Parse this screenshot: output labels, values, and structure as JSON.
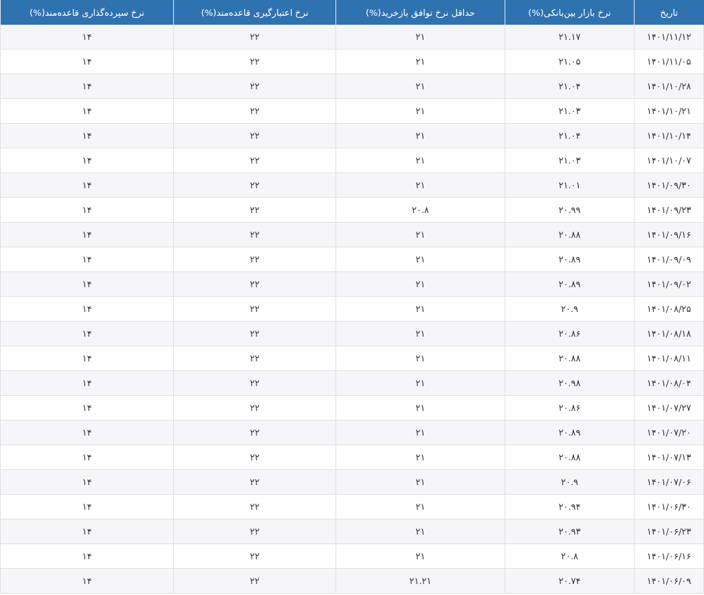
{
  "table": {
    "columns": [
      "تاریخ",
      "نرخ بازار بین‌بانکی(%)",
      "حداقل نرخ توافق بازخرید(%)",
      "نرخ اعتبارگیری قاعده‌مند(%)",
      "نرخ سپرده‌گذاری قاعده‌مند(%)"
    ],
    "rows": [
      [
        "۱۴۰۱/۱۱/۱۲",
        "۲۱.۱۷",
        "۲۱",
        "۲۲",
        "۱۴"
      ],
      [
        "۱۴۰۱/۱۱/۰۵",
        "۲۱.۰۵",
        "۲۱",
        "۲۲",
        "۱۴"
      ],
      [
        "۱۴۰۱/۱۰/۲۸",
        "۲۱.۰۴",
        "۲۱",
        "۲۲",
        "۱۴"
      ],
      [
        "۱۴۰۱/۱۰/۲۱",
        "۲۱.۰۳",
        "۲۱",
        "۲۲",
        "۱۴"
      ],
      [
        "۱۴۰۱/۱۰/۱۴",
        "۲۱.۰۴",
        "۲۱",
        "۲۲",
        "۱۴"
      ],
      [
        "۱۴۰۱/۱۰/۰۷",
        "۲۱.۰۳",
        "۲۱",
        "۲۲",
        "۱۴"
      ],
      [
        "۱۴۰۱/۰۹/۳۰",
        "۲۱.۰۱",
        "۲۱",
        "۲۲",
        "۱۴"
      ],
      [
        "۱۴۰۱/۰۹/۲۳",
        "۲۰.۹۹",
        "۲۰.۸",
        "۲۲",
        "۱۴"
      ],
      [
        "۱۴۰۱/۰۹/۱۶",
        "۲۰.۸۸",
        "۲۱",
        "۲۲",
        "۱۴"
      ],
      [
        "۱۴۰۱/۰۹/۰۹",
        "۲۰.۸۹",
        "۲۱",
        "۲۲",
        "۱۴"
      ],
      [
        "۱۴۰۱/۰۹/۰۲",
        "۲۰.۸۹",
        "۲۱",
        "۲۲",
        "۱۴"
      ],
      [
        "۱۴۰۱/۰۸/۲۵",
        "۲۰.۹",
        "۲۱",
        "۲۲",
        "۱۴"
      ],
      [
        "۱۴۰۱/۰۸/۱۸",
        "۲۰.۸۶",
        "۲۱",
        "۲۲",
        "۱۴"
      ],
      [
        "۱۴۰۱/۰۸/۱۱",
        "۲۰.۸۸",
        "۲۱",
        "۲۲",
        "۱۴"
      ],
      [
        "۱۴۰۱/۰۸/۰۴",
        "۲۰.۹۸",
        "۲۱",
        "۲۲",
        "۱۴"
      ],
      [
        "۱۴۰۱/۰۷/۲۷",
        "۲۰.۸۶",
        "۲۱",
        "۲۲",
        "۱۴"
      ],
      [
        "۱۴۰۱/۰۷/۲۰",
        "۲۰.۸۹",
        "۲۱",
        "۲۲",
        "۱۴"
      ],
      [
        "۱۴۰۱/۰۷/۱۳",
        "۲۰.۸۸",
        "۲۱",
        "۲۲",
        "۱۴"
      ],
      [
        "۱۴۰۱/۰۷/۰۶",
        "۲۰.۹",
        "۲۱",
        "۲۲",
        "۱۴"
      ],
      [
        "۱۴۰۱/۰۶/۳۰",
        "۲۰.۹۴",
        "۲۱",
        "۲۲",
        "۱۴"
      ],
      [
        "۱۴۰۱/۰۶/۲۳",
        "۲۰.۹۳",
        "۲۱",
        "۲۲",
        "۱۴"
      ],
      [
        "۱۴۰۱/۰۶/۱۶",
        "۲۰.۸",
        "۲۱",
        "۲۲",
        "۱۴"
      ],
      [
        "۱۴۰۱/۰۶/۰۹",
        "۲۰.۷۴",
        "۲۱.۲۱",
        "۲۲",
        "۱۴"
      ]
    ]
  }
}
